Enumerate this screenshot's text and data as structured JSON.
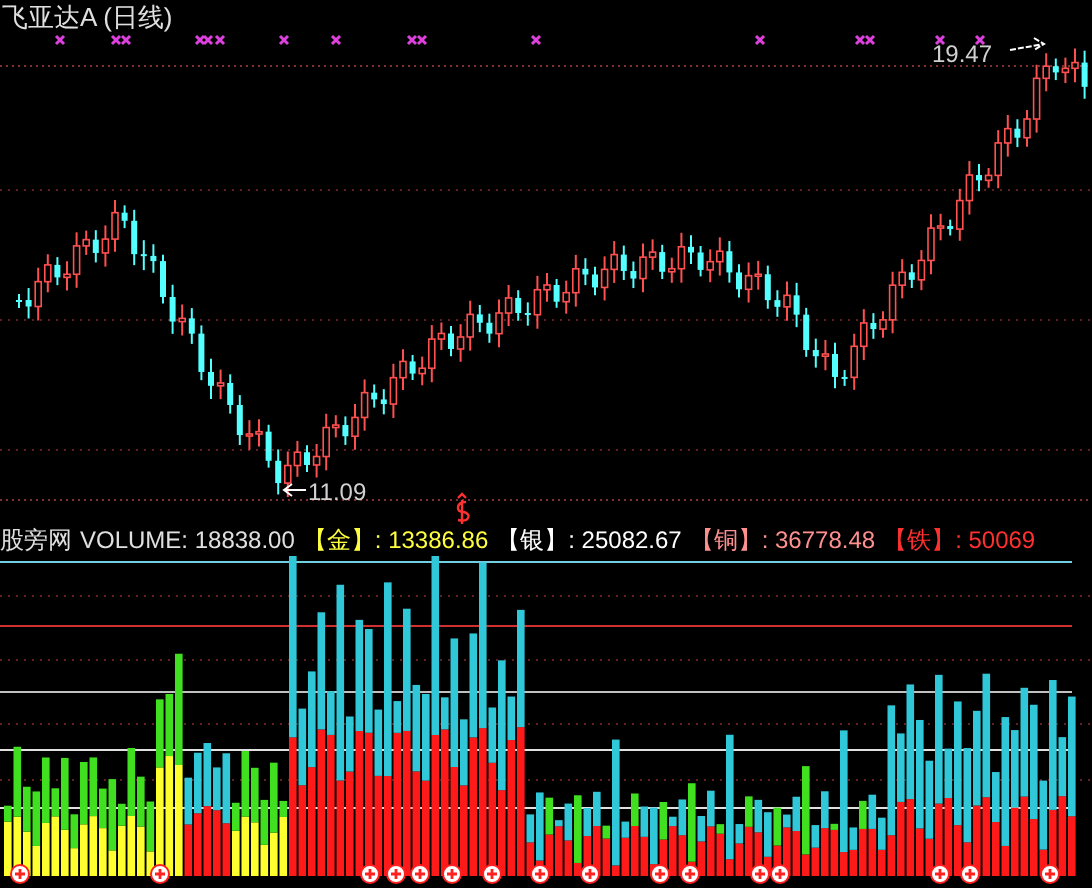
{
  "title": "飞亚达A (日线)",
  "price_high": {
    "label": "19.47"
  },
  "price_low": {
    "label": "11.09"
  },
  "legend": {
    "name": "股旁网",
    "indicator": "VOLUME: 18838.00",
    "items": [
      {
        "label": "【金】",
        "value": ": 13386.86",
        "color": "#ffff40"
      },
      {
        "label": "【银】",
        "value": ": 25082.67",
        "color": "#ffffff"
      },
      {
        "label": "【铜】",
        "value": ": 36778.48",
        "color": "#ff9090"
      },
      {
        "label": "【铁】",
        "value": ": 50069",
        "color": "#ff3030"
      }
    ]
  }
}
